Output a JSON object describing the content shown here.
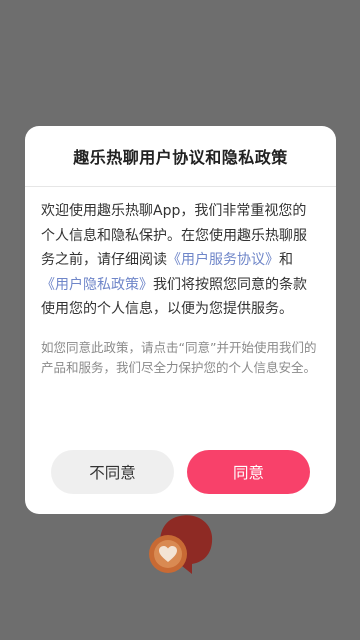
{
  "dialog": {
    "title": "趣乐热聊用户协议和隐私政策",
    "body_before_link1": "欢迎使用趣乐热聊App，我们非常重视您的个人信息和隐私保护。在您使用趣乐热聊服务之前，请仔细阅读",
    "link_user_agreement": "《用户服务协议》",
    "body_and": "和",
    "link_privacy_policy": "《用户隐私政策》",
    "body_after_links": "我们将按照您同意的条款使用您的个人信息，以便为您提供服务。",
    "note": "如您同意此政策，请点击“同意”并开始使用我们的产品和服务，我们尽全力保护您的个人信息安全。",
    "disagree_label": "不同意",
    "agree_label": "同意"
  },
  "colors": {
    "accent": "#f8416a",
    "link": "#6f86c9",
    "overlay": "#6e6e6e"
  },
  "background": {
    "logo_icon": "chat-heart-icon"
  }
}
